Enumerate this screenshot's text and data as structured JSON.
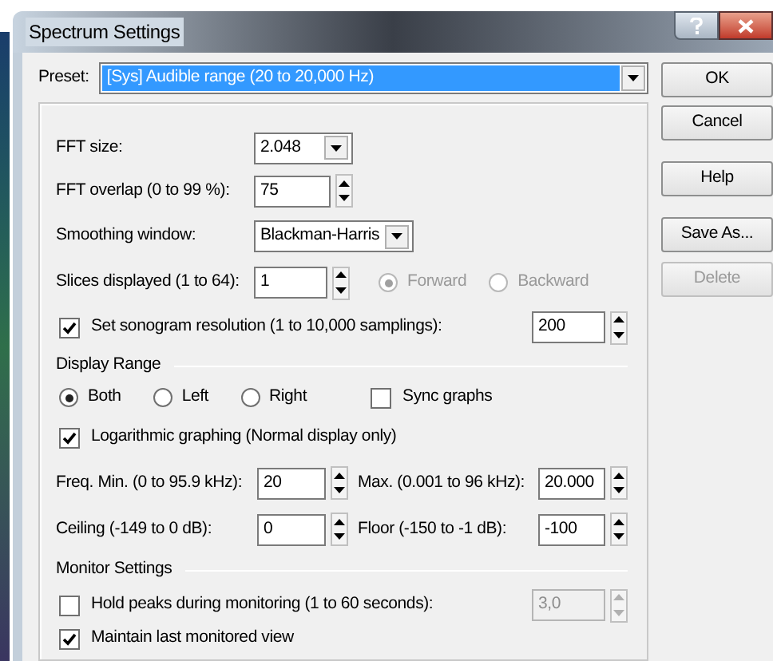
{
  "window": {
    "title": "Spectrum Settings"
  },
  "preset": {
    "label": "Preset:",
    "value": "[Sys] Audible range (20 to 20,000 Hz)"
  },
  "buttons": [
    {
      "label": "OK",
      "disabled": false
    },
    {
      "label": "Cancel",
      "disabled": false
    },
    {
      "label": "Help",
      "disabled": false
    },
    {
      "label": "Save As...",
      "disabled": false
    },
    {
      "label": "Delete",
      "disabled": true
    }
  ],
  "fft_size": {
    "label": "FFT size:",
    "value": "2.048"
  },
  "fft_overlap": {
    "label": "FFT overlap (0 to 99 %):",
    "value": "75"
  },
  "smoothing_window": {
    "label": "Smoothing window:",
    "value": "Blackman-Harris"
  },
  "slices": {
    "label": "Slices displayed (1 to 64):",
    "value": "1",
    "direction": [
      {
        "label": "Forward",
        "selected": true,
        "disabled": true
      },
      {
        "label": "Backward",
        "selected": false,
        "disabled": true
      }
    ]
  },
  "sonogram": {
    "label": "Set sonogram resolution (1 to 10,000 samplings):",
    "checked": true,
    "value": "200"
  },
  "display_range": {
    "heading": "Display Range",
    "channels": [
      {
        "label": "Both",
        "selected": true
      },
      {
        "label": "Left",
        "selected": false
      },
      {
        "label": "Right",
        "selected": false
      }
    ],
    "sync_graphs": {
      "label": "Sync graphs",
      "checked": false
    }
  },
  "logarithmic": {
    "label": "Logarithmic graphing (Normal display only)",
    "checked": true
  },
  "freq_min": {
    "label": "Freq. Min. (0 to 95.9 kHz):",
    "value": "20"
  },
  "freq_max": {
    "label": "Max. (0.001 to 96 kHz):",
    "value": "20.000"
  },
  "ceiling": {
    "label": "Ceiling (-149 to 0 dB):",
    "value": "0"
  },
  "floor": {
    "label": "Floor (-150 to -1 dB):",
    "value": "-100"
  },
  "monitor": {
    "heading": "Monitor Settings",
    "hold_peaks": {
      "label": "Hold peaks during monitoring (1 to 60 seconds):",
      "checked": false,
      "value": "3,0",
      "disabled": true
    },
    "maintain_view": {
      "label": "Maintain last monitored view",
      "checked": true
    }
  }
}
